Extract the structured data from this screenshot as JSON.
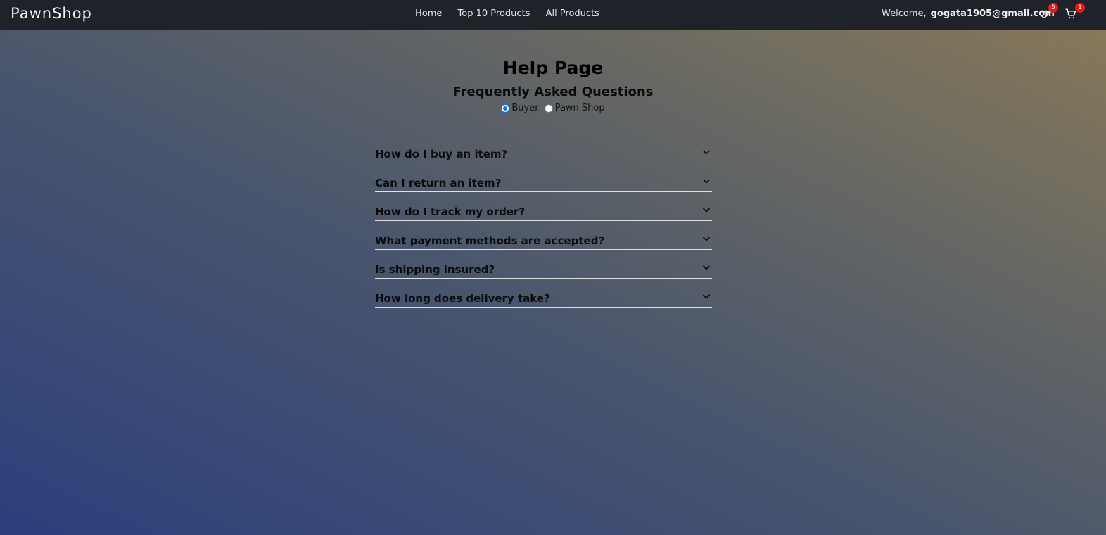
{
  "header": {
    "brand": "PawnShop",
    "nav": [
      "Home",
      "Top 10 Products",
      "All Products"
    ],
    "welcome_label": "Welcome,",
    "user_email": "gogata1905@gmail.com",
    "wishlist": {
      "icon": "heart-icon",
      "count": "5"
    },
    "cart": {
      "icon": "cart-icon",
      "count": "1"
    }
  },
  "main": {
    "title": "Help Page",
    "subtitle": "Frequently Asked Questions",
    "radios": [
      {
        "label": "Buyer",
        "checked": true
      },
      {
        "label": "Pawn Shop",
        "checked": false
      }
    ],
    "faqs": [
      "How do I buy an item?",
      "Can I return an item?",
      "How do I track my order?",
      "What payment methods are accepted?",
      "Is shipping insured?",
      "How long does delivery take?"
    ]
  },
  "colors": {
    "navbar": "#1f2229",
    "badge": "#e31b1b",
    "radio_accent": "#1a73e8"
  }
}
